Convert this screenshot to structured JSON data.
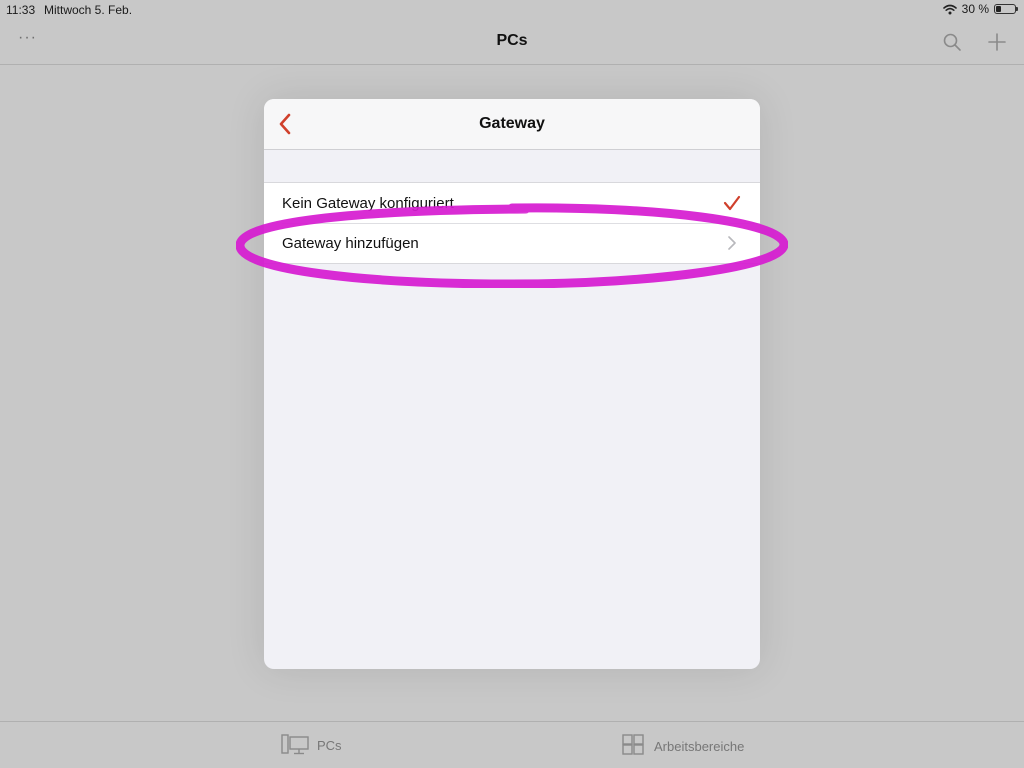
{
  "status_bar": {
    "time": "11:33",
    "date": "Mittwoch 5. Feb.",
    "battery_text": "30 %",
    "battery_level": 0.3,
    "icons": [
      "wifi-icon",
      "battery-icon"
    ]
  },
  "nav": {
    "title": "PCs",
    "more_label": "···",
    "icons": [
      "more-icon",
      "search-icon",
      "plus-icon"
    ]
  },
  "modal": {
    "title": "Gateway",
    "back_icon": "chevron-left-icon",
    "rows": [
      {
        "label": "Kein Gateway konfiguriert",
        "accessory": "checkmark-icon",
        "selected": true
      },
      {
        "label": "Gateway hinzufügen",
        "accessory": "chevron-right-icon",
        "selected": false
      }
    ]
  },
  "tab_bar": {
    "items": [
      {
        "label": "PCs",
        "icon": "desktop-icon"
      },
      {
        "label": "Arbeitsbereiche",
        "icon": "workspaces-grid-icon"
      }
    ]
  },
  "colors": {
    "accent": "#d0402c",
    "annotation": "#d61ad0",
    "backdrop": "#c8c8c8",
    "modal_background": "#f1f1f6",
    "row_background": "#ffffff"
  }
}
